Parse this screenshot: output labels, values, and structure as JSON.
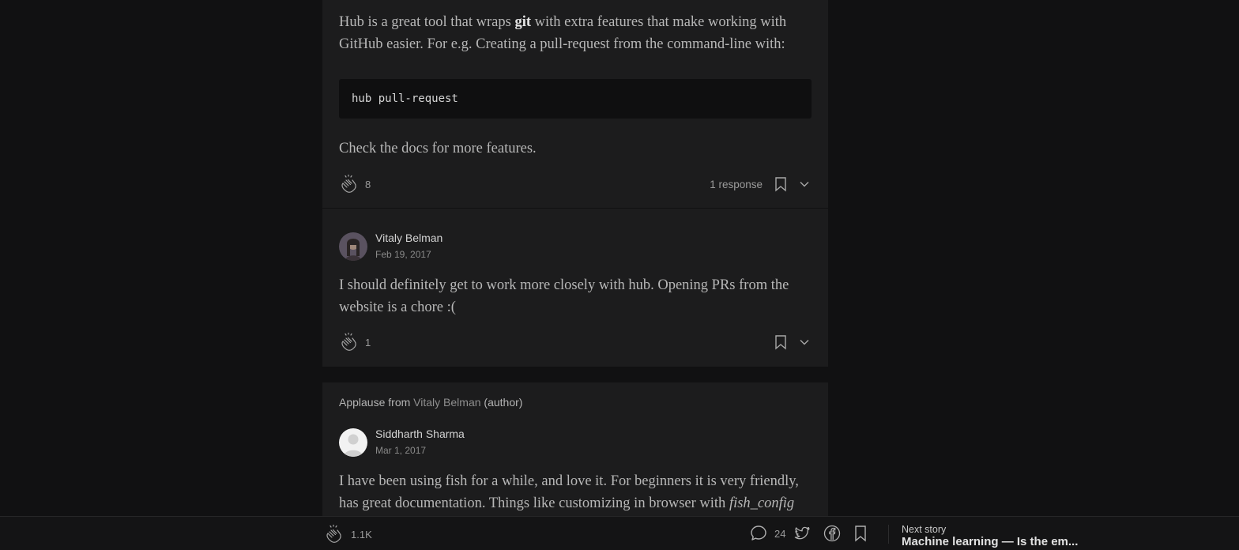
{
  "response1": {
    "text_before": "Hub is a great tool that wraps ",
    "text_bold": "git",
    "text_after": " with extra features that make working with GitHub easier. For e.g. Creating a pull-request from the command-line with:",
    "code": "hub pull-request",
    "followup": "Check the docs for more features.",
    "clap_count": "8",
    "responses_label": "1 response"
  },
  "response2": {
    "author": "Vitaly Belman",
    "date": "Feb 19, 2017",
    "text": "I should definitely get to work more closely with hub. Opening PRs from the website is a chore :(",
    "clap_count": "1"
  },
  "response3": {
    "applause_prefix": "Applause from ",
    "applause_name": "Vitaly Belman",
    "applause_suffix": " (author)",
    "author": "Siddharth Sharma",
    "date": "Mar 1, 2017",
    "text_before": "I have been using fish for a while, and love it. For beginners it is very friendly, has great documentation. Things like customizing in browser with ",
    "text_italic": "fish_config"
  },
  "bottom_bar": {
    "clap_count": "1.1K",
    "response_count": "24",
    "next_label": "Next story",
    "next_title": "Machine learning — Is the em..."
  },
  "icons": {
    "clap": "clap-icon",
    "bookmark": "bookmark-icon",
    "chevron": "chevron-down-icon",
    "comment": "comment-icon",
    "twitter": "twitter-icon",
    "facebook": "facebook-icon"
  },
  "colors": {
    "background": "#111112",
    "card": "#1c1c1d",
    "code_bg": "#0f0f10"
  }
}
